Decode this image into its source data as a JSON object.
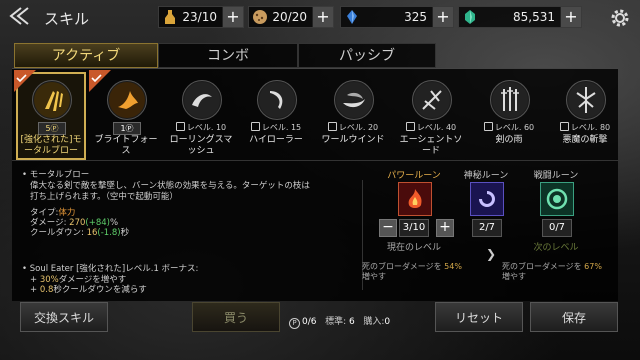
{
  "header": {
    "title": "スキル",
    "resources": [
      {
        "icon": "potion-icon",
        "value": "23/10"
      },
      {
        "icon": "cookie-icon",
        "value": "20/20"
      },
      {
        "icon": "blue-crystal-icon",
        "value": "325"
      },
      {
        "icon": "green-gem-icon",
        "value": "85,531"
      }
    ]
  },
  "tabs": [
    "アクティブ",
    "コンボ",
    "パッシブ"
  ],
  "skills": [
    {
      "name": "[強化された]モータルブロー",
      "cost": "5",
      "req": "",
      "selected": true,
      "ribbon": true
    },
    {
      "name": "ブライトフォース",
      "cost": "1",
      "req": "",
      "selected": false,
      "ribbon": true
    },
    {
      "name": "ローリングスマッシュ",
      "cost": "",
      "req": "レベル. 10"
    },
    {
      "name": "ハイローラー",
      "cost": "",
      "req": "レベル. 15"
    },
    {
      "name": "ワールウインド",
      "cost": "",
      "req": "レベル. 20"
    },
    {
      "name": "エーシェントソード",
      "cost": "",
      "req": "レベル. 40"
    },
    {
      "name": "剣の雨",
      "cost": "",
      "req": "レベル. 60"
    },
    {
      "name": "悪魔の斬撃",
      "cost": "",
      "req": "レベル. 80"
    }
  ],
  "detail": {
    "name": "モータルブロー",
    "desc1": "偉大なる剣で敵を撃墜し、バーン状態の効果を与える。ターゲットの枝は",
    "desc2": "打ち上げられます。（空中で起動可能）",
    "type_label": "タイプ:",
    "type_value": "体力",
    "damage_label": "ダメージ: ",
    "damage_value": "270",
    "damage_bonus": "(+84)",
    "damage_unit": "%",
    "cooldown_label": "クールダウン: ",
    "cooldown_value": "16",
    "cooldown_bonus": "(-1.8)",
    "cooldown_unit": "秒",
    "bonus_title": "Soul Eater [強化された]レベル.1 ボーナス:",
    "bonus1_prefix": "+ ",
    "bonus1_value": "30%",
    "bonus1_text": "ダメージを増やす",
    "bonus2_prefix": "+ ",
    "bonus2_value": "0.8",
    "bonus2_text": "秒クールダウンを減らす"
  },
  "runes": {
    "power": {
      "title": "パワールーン",
      "count": "3/10",
      "caption": "現在のレベル",
      "bonus_text": "死のブローダメージを",
      "bonus_pct": "54%",
      "bonus_tail": "増やす"
    },
    "secret": {
      "title": "神秘ルーン",
      "count": "2/7"
    },
    "battle": {
      "title": "戦闘ルーン",
      "count": "0/7",
      "caption": "次のレベル",
      "bonus_text": "死のブローダメージを",
      "bonus_pct": "67%",
      "bonus_tail": "増やす"
    }
  },
  "footer": {
    "exchange": "交換スキル",
    "buy": "買う",
    "points": "0/6",
    "standard_label": "標準:",
    "standard_value": "6",
    "purchase_label": "購入:",
    "purchase_value": "0",
    "reset": "リセット",
    "save": "保存"
  }
}
